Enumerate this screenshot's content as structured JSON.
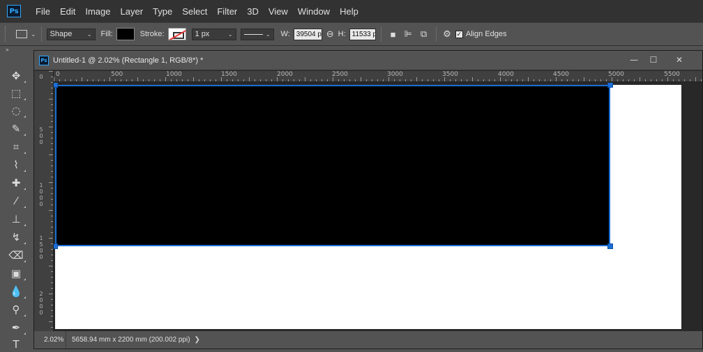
{
  "app": {
    "logo": "Ps"
  },
  "menu": [
    "File",
    "Edit",
    "Image",
    "Layer",
    "Type",
    "Select",
    "Filter",
    "3D",
    "View",
    "Window",
    "Help"
  ],
  "options": {
    "mode": "Shape",
    "fill_label": "Fill:",
    "fill_color": "#000000",
    "stroke_label": "Stroke:",
    "stroke_width": "1 px",
    "w_label": "W:",
    "w_value": "39504 p",
    "h_label": "H:",
    "h_value": "11533 p",
    "align_edges_label": "Align Edges",
    "align_edges_checked": true
  },
  "document": {
    "ps_icon": "Ps",
    "title": "Untitled-1 @ 2.02% (Rectangle 1, RGB/8*) *",
    "window_buttons": [
      "—",
      "☐",
      "✕"
    ],
    "ruler_top": [
      "0",
      "500",
      "1000",
      "1500",
      "2000",
      "2500",
      "3000",
      "3500",
      "4000",
      "4500",
      "5000",
      "5500"
    ],
    "ruler_left": [
      [
        "0"
      ],
      [
        "5",
        "0",
        "0"
      ],
      [
        "1",
        "0",
        "0",
        "0"
      ],
      [
        "1",
        "5",
        "0",
        "0"
      ],
      [
        "2",
        "0",
        "0",
        "0"
      ]
    ],
    "status_zoom": "2.02%",
    "status_info": "5658.94 mm x 2200 mm (200.002 ppi)",
    "status_arrow": "❯"
  },
  "tools": [
    {
      "name": "move-tool",
      "icon": "✥"
    },
    {
      "name": "marquee-tool",
      "icon": "⬚"
    },
    {
      "name": "lasso-tool",
      "icon": "◌"
    },
    {
      "name": "quick-select-tool",
      "icon": "✎"
    },
    {
      "name": "crop-tool",
      "icon": "⌗"
    },
    {
      "name": "eyedropper-tool",
      "icon": "⌇"
    },
    {
      "name": "healing-brush-tool",
      "icon": "✚"
    },
    {
      "name": "brush-tool",
      "icon": "⁄"
    },
    {
      "name": "clone-stamp-tool",
      "icon": "⊥"
    },
    {
      "name": "history-brush-tool",
      "icon": "↯"
    },
    {
      "name": "eraser-tool",
      "icon": "⌫"
    },
    {
      "name": "gradient-tool",
      "icon": "▣"
    },
    {
      "name": "blur-tool",
      "icon": "💧"
    },
    {
      "name": "dodge-tool",
      "icon": "⚲"
    },
    {
      "name": "pen-tool",
      "icon": "✒"
    },
    {
      "name": "type-tool",
      "icon": "T"
    }
  ]
}
